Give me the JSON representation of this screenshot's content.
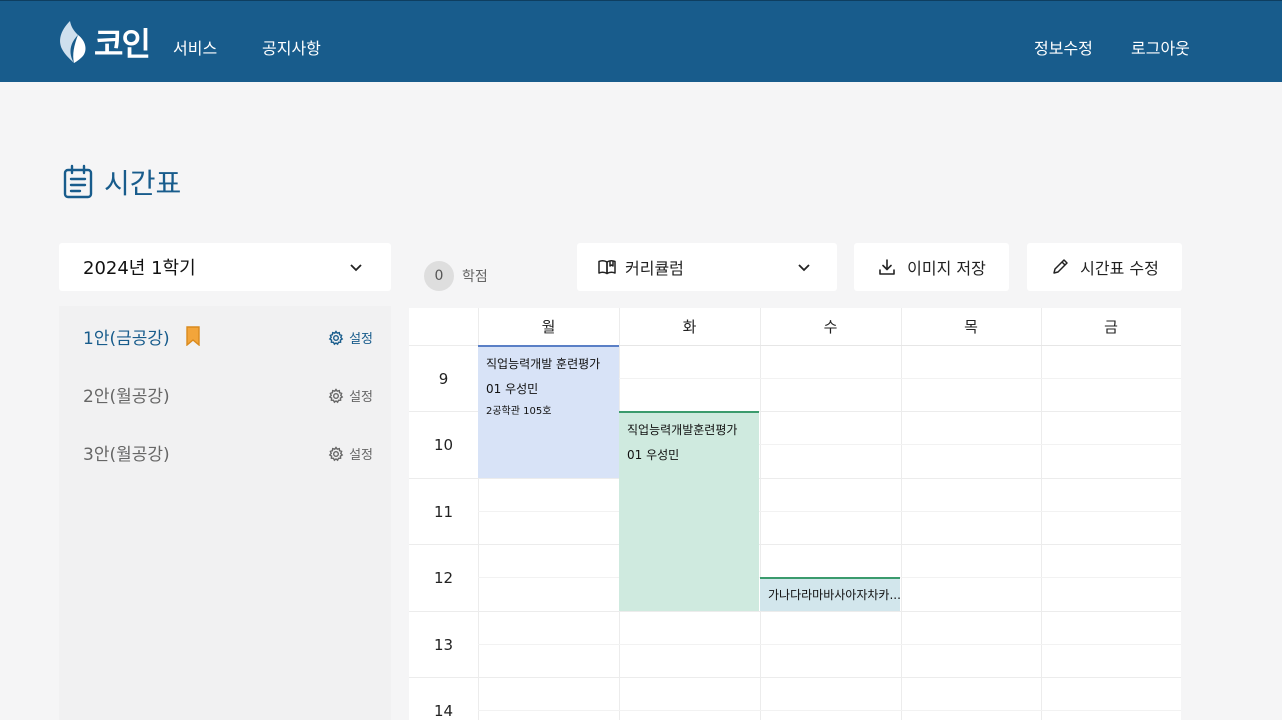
{
  "header": {
    "logo_text": "코인",
    "nav_left": [
      "서비스",
      "공지사항"
    ],
    "nav_right": [
      "정보수정",
      "로그아웃"
    ],
    "bg_color": "#185c8c"
  },
  "page": {
    "title": "시간표",
    "title_icon": "calendar-icon"
  },
  "semester": {
    "selected": "2024년 1학기"
  },
  "plans": [
    {
      "label": "1안(금공강)",
      "settings_label": "설정",
      "active": true,
      "bookmarked": true
    },
    {
      "label": "2안(월공강)",
      "settings_label": "설정",
      "active": false,
      "bookmarked": false
    },
    {
      "label": "3안(월공강)",
      "settings_label": "설정",
      "active": false,
      "bookmarked": false
    }
  ],
  "credits": {
    "value": "0",
    "label": "학점"
  },
  "toolbar": {
    "curriculum_label": "커리큘럼",
    "save_image_label": "이미지 저장",
    "edit_label": "시간표 수정"
  },
  "timetable": {
    "days": [
      "월",
      "화",
      "수",
      "목",
      "금"
    ],
    "hours": [
      "9",
      "10",
      "11",
      "12",
      "13",
      "14"
    ],
    "courses": [
      {
        "title": "직업능력개발 훈련평가",
        "prof": "01 우성민",
        "room": "2공학관 105호",
        "day": "월",
        "color": "#d8e3f7"
      },
      {
        "title": "직업능력개발훈련평가",
        "prof": "01 우성민",
        "day": "화",
        "color": "#cfeadf"
      },
      {
        "title": "가나다라마바사아자차카...",
        "day": "수",
        "color": "#d2e6ec"
      }
    ]
  }
}
